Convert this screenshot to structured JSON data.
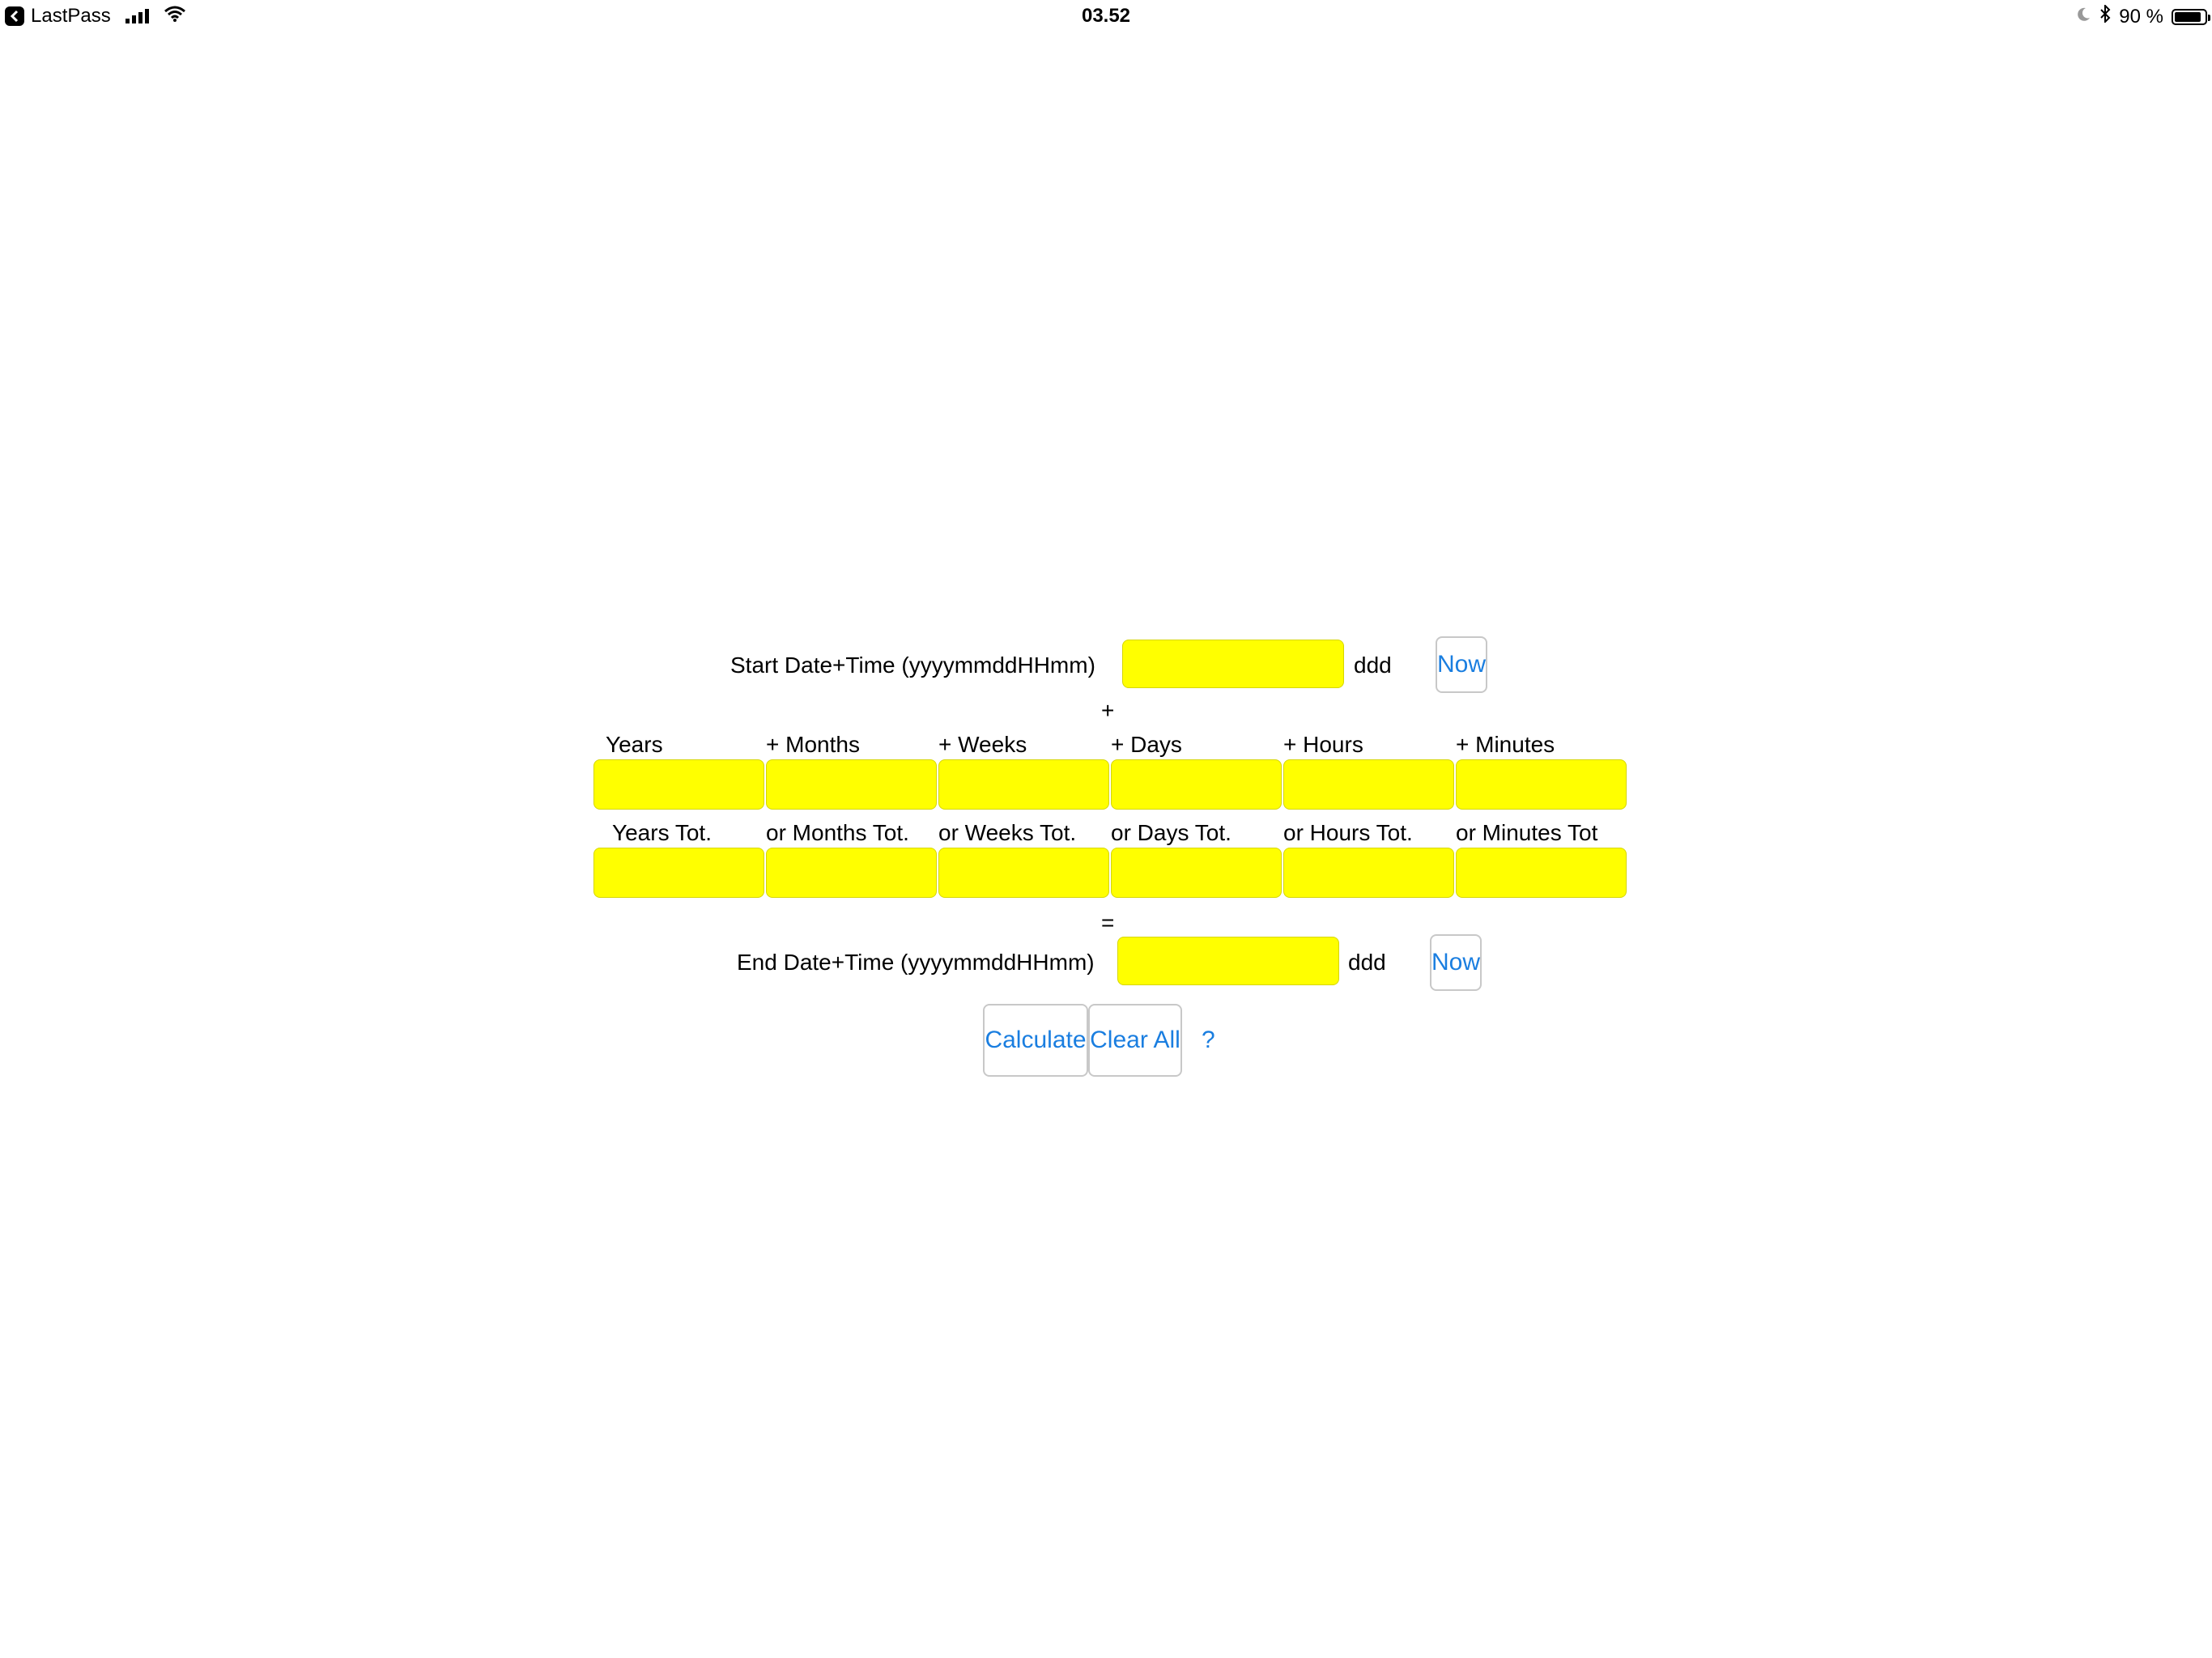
{
  "status_bar": {
    "back_app": "LastPass",
    "time": "03.52",
    "battery_percent": "90 %",
    "battery_level": 0.9
  },
  "start": {
    "label": "Start Date+Time (yyyymmddHHmm)",
    "value": "",
    "weekday": "ddd",
    "now_label": "Now"
  },
  "plus_sign": "+",
  "increments": {
    "labels": [
      "Years",
      "+ Months",
      "+ Weeks",
      "+ Days",
      "+ Hours",
      "+ Minutes"
    ],
    "values": [
      "",
      "",
      "",
      "",
      "",
      ""
    ]
  },
  "totals": {
    "labels": [
      "Years Tot.",
      "or Months Tot.",
      "or Weeks Tot.",
      "or Days Tot.",
      "or Hours Tot.",
      "or Minutes Tot"
    ],
    "values": [
      "",
      "",
      "",
      "",
      "",
      ""
    ]
  },
  "equals_sign": "=",
  "end": {
    "label": "End Date+Time (yyyymmddHHmm)",
    "value": "",
    "weekday": "ddd",
    "now_label": "Now"
  },
  "actions": {
    "calculate_label": "Calculate",
    "clear_label": "Clear All",
    "help_label": "?"
  },
  "colors": {
    "field_background": "#ffff00",
    "link_blue": "#1a7ee0"
  }
}
